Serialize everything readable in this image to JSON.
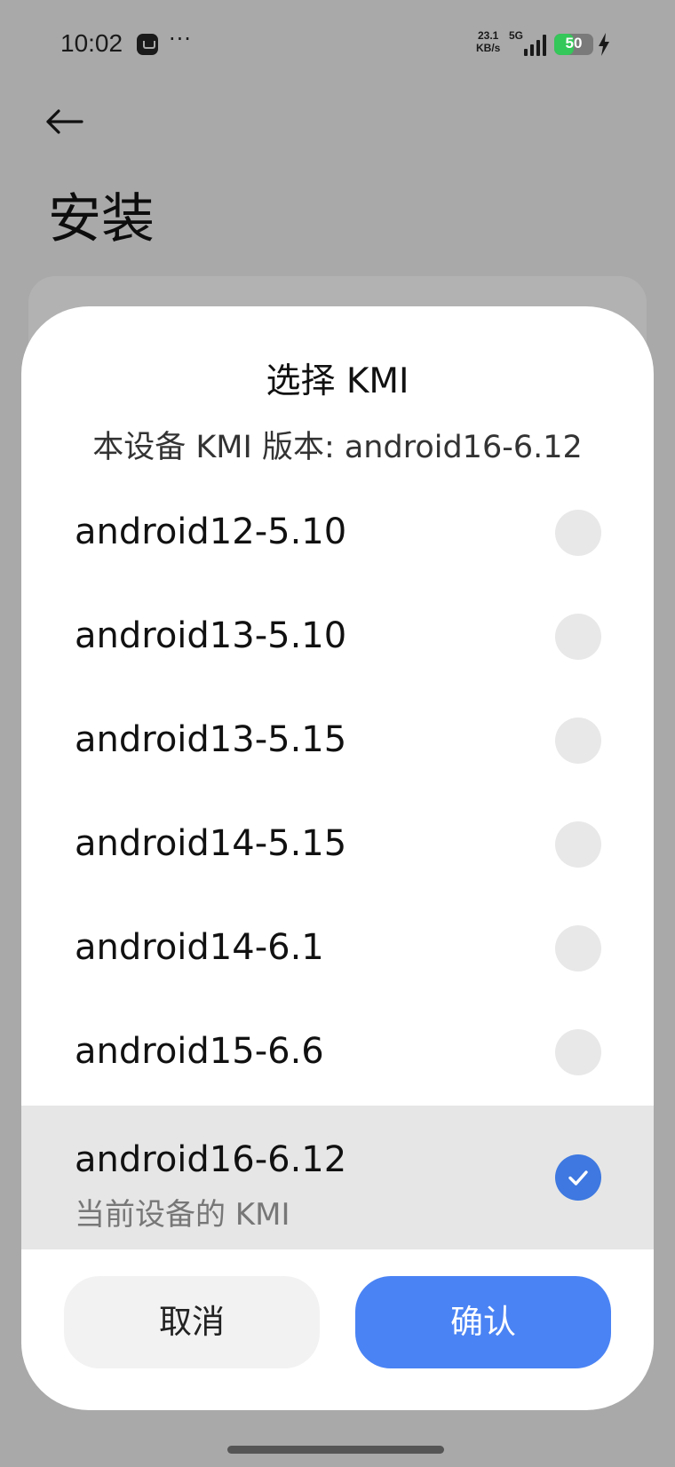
{
  "status_bar": {
    "time": "10:02",
    "more": "···",
    "net_speed_value": "23.1",
    "net_speed_unit": "KB/s",
    "net_type": "5G",
    "battery": "50",
    "battery_level": 0.5
  },
  "page": {
    "title": "安装"
  },
  "dialog": {
    "title": "选择 KMI",
    "subtitle": "本设备 KMI 版本: android16-6.12",
    "items": [
      {
        "label": "android12-5.10",
        "selected": false
      },
      {
        "label": "android13-5.10",
        "selected": false
      },
      {
        "label": "android13-5.15",
        "selected": false
      },
      {
        "label": "android14-5.15",
        "selected": false
      },
      {
        "label": "android14-6.1",
        "selected": false
      },
      {
        "label": "android15-6.6",
        "selected": false
      },
      {
        "label": "android16-6.12",
        "sublabel": "当前设备的 KMI",
        "selected": true
      }
    ],
    "cancel_label": "取消",
    "confirm_label": "确认"
  },
  "colors": {
    "accent": "#4a83f4",
    "radio_selected": "#3e78e0",
    "battery_green": "#34c759"
  },
  "icons": {
    "back": "back-arrow-icon",
    "check": "check-icon",
    "charging": "lightning-icon"
  }
}
